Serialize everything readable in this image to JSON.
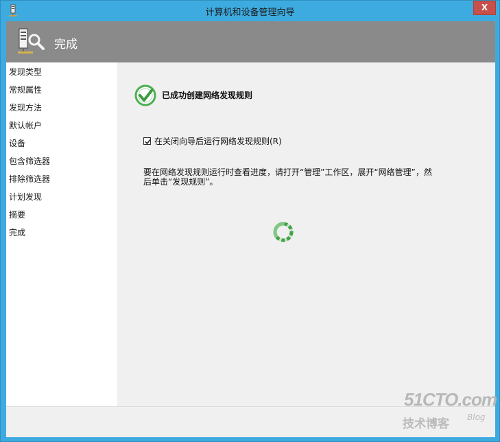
{
  "window": {
    "title": "计算机和设备管理向导",
    "close_label": "X"
  },
  "header": {
    "title": "完成"
  },
  "sidebar": {
    "items": [
      {
        "label": "发现类型"
      },
      {
        "label": "常规属性"
      },
      {
        "label": "发现方法"
      },
      {
        "label": "默认帐户"
      },
      {
        "label": "设备"
      },
      {
        "label": "包含筛选器"
      },
      {
        "label": "排除筛选器"
      },
      {
        "label": "计划发现"
      },
      {
        "label": "摘要"
      },
      {
        "label": "完成"
      }
    ]
  },
  "main": {
    "success_message": "已成功创建网络发现规则",
    "checkbox": {
      "label": "在关闭向导后运行网络发现规则(R)",
      "checked": true
    },
    "info_line1": "要在网络发现规则运行时查看进度，请打开“管理”工作区，展开“网络管理”，然",
    "info_line2": "后单击“发现规则”。"
  },
  "watermark": {
    "site": "51CTO.com",
    "subtitle": "技术博客",
    "blog": "Blog"
  },
  "colors": {
    "titlebar": "#3dabe0",
    "header_band": "#8a8a8a",
    "close_button": "#c7504a",
    "success_green": "#4caf50",
    "panel": "#f0f0f0"
  }
}
